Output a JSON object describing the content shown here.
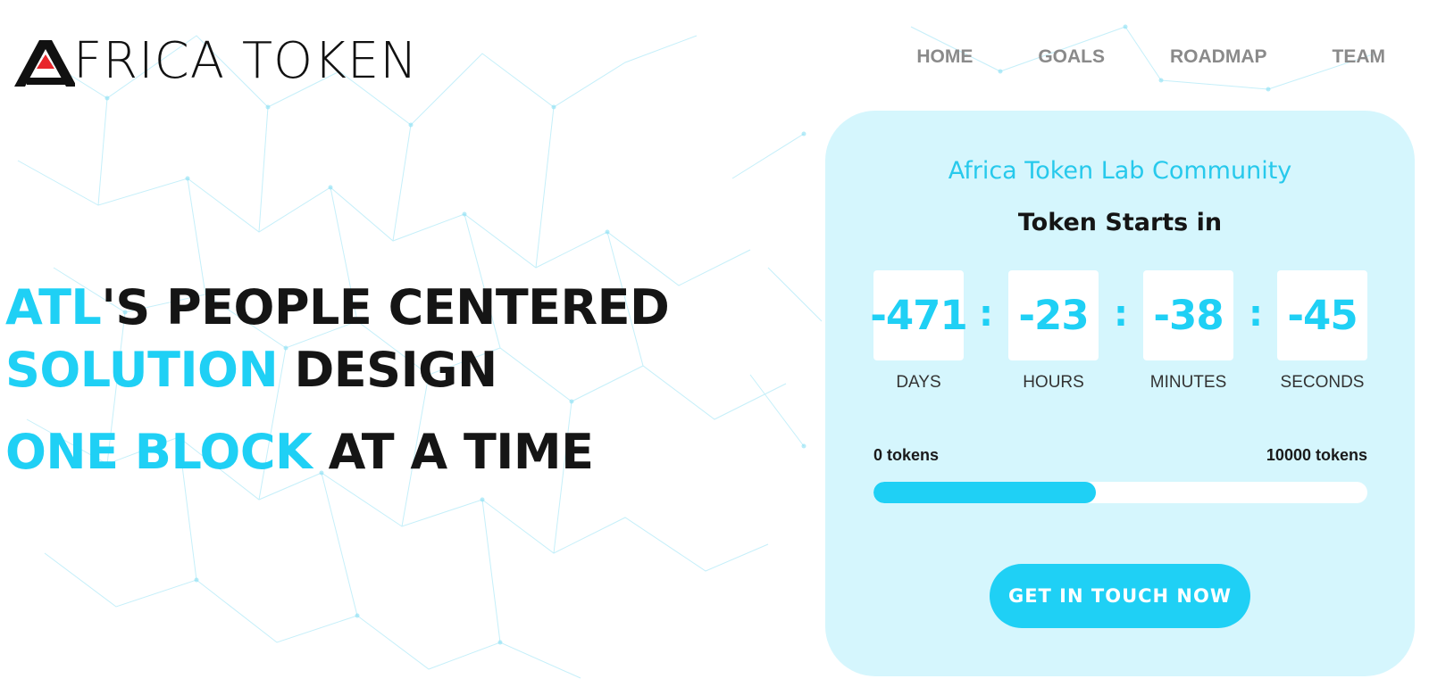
{
  "brand": {
    "name": "FRICA TOKEN",
    "logo_letter": "A",
    "logo_accent_color": "#e8262b"
  },
  "nav": {
    "items": [
      {
        "label": "HOME"
      },
      {
        "label": "GOALS"
      },
      {
        "label": "ROADMAP"
      },
      {
        "label": "TEAM"
      }
    ]
  },
  "hero": {
    "line1_accent": "ATL",
    "line1_rest": "'S PEOPLE CENTERED",
    "line2_accent": "SOLUTION",
    "line2_rest": "DESIGN",
    "line3_accent": "ONE BLOCK",
    "line3_rest": "AT A TIME"
  },
  "card": {
    "subtitle": "Africa Token Lab Community",
    "title": "Token Starts in",
    "countdown": {
      "days": {
        "value": "-471",
        "label": "DAYS"
      },
      "hours": {
        "value": "-23",
        "label": "HOURS"
      },
      "minutes": {
        "value": "-38",
        "label": "MINUTES"
      },
      "seconds": {
        "value": "-45",
        "label": "SECONDS"
      },
      "separator": ":"
    },
    "tokens": {
      "min_label": "0 tokens",
      "max_label": "10000 tokens",
      "progress_fraction": 0.45
    },
    "cta_label": "GET IN TOUCH NOW"
  },
  "colors": {
    "accent": "#1fd0f5",
    "card_bg": "#d5f6fd",
    "text_dark": "#151515",
    "nav_text": "#8a8a8a"
  }
}
